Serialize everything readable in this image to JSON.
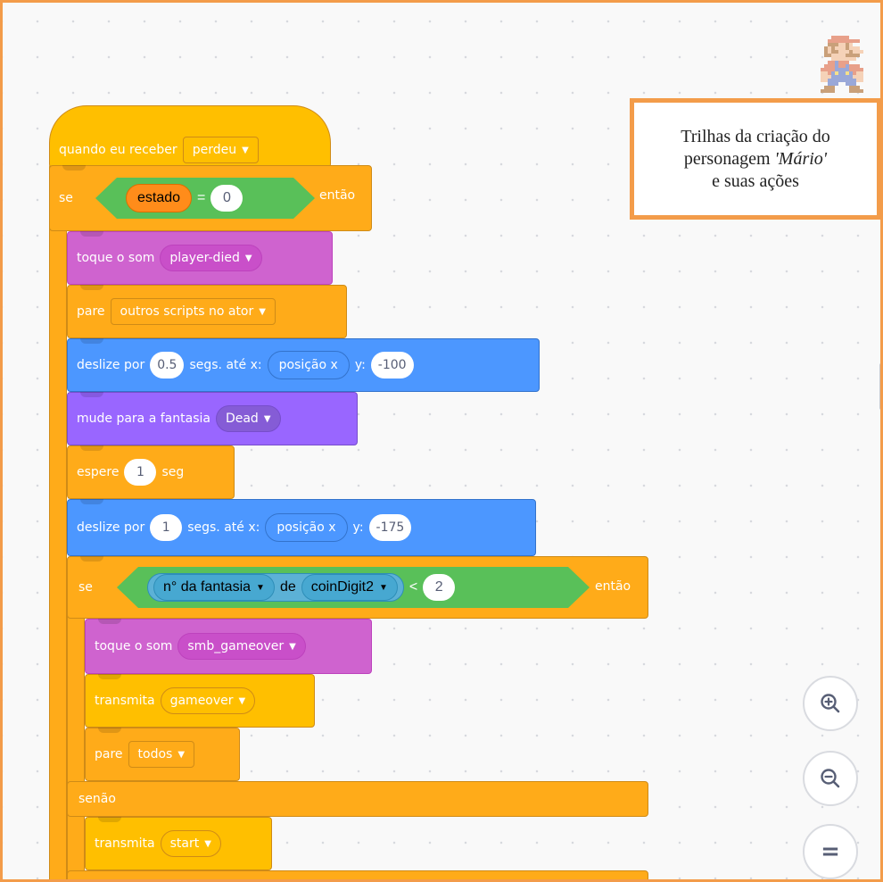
{
  "note": {
    "line1": "Trilhas da criação do",
    "line2_prefix": "personagem ",
    "line2_italic": "'Mário'",
    "line3": "e suas ações"
  },
  "sprite": {
    "name": "mario-sprite-icon"
  },
  "script": {
    "hat": {
      "label": "quando eu receber",
      "message": "perdeu"
    },
    "if1": {
      "label": "se",
      "var": "estado",
      "op": "=",
      "value": "0",
      "then": "então"
    },
    "play_died": {
      "label": "toque o som",
      "sound": "player-died"
    },
    "stop_other": {
      "label": "pare",
      "option": "outros scripts no ator"
    },
    "glide1": {
      "label": "deslize por",
      "secs": "0.5",
      "label2": "segs. até x:",
      "x": "posição x",
      "label3": "y:",
      "y": "-100"
    },
    "costume": {
      "label": "mude para a fantasia",
      "costume": "Dead"
    },
    "wait": {
      "label": "espere",
      "secs": "1",
      "unit": "seg"
    },
    "glide2": {
      "label": "deslize por",
      "secs": "1",
      "label2": "segs. até x:",
      "x": "posição x",
      "label3": "y:",
      "y": "-175"
    },
    "if2": {
      "label": "se",
      "prop": "n° da fantasia",
      "of": "de",
      "sprite": "coinDigit2",
      "op": "<",
      "value": "2",
      "then": "então"
    },
    "play_gameover": {
      "label": "toque o som",
      "sound": "smb_gameover"
    },
    "broadcast_go": {
      "label": "transmita",
      "message": "gameover"
    },
    "stop_all": {
      "label": "pare",
      "option": "todos"
    },
    "else": {
      "label": "senão"
    },
    "broadcast_start": {
      "label": "transmita",
      "message": "start"
    }
  },
  "zoom": {
    "in": "zoom-in",
    "out": "zoom-out",
    "reset": "="
  },
  "colors": {
    "control": "#ffab19",
    "events": "#ffbf00",
    "sound": "#cf63cf",
    "looks": "#9966ff",
    "motion": "#4c97ff",
    "operators": "#59c059",
    "variables": "#ff8c1a",
    "border": "#f39c4a"
  }
}
